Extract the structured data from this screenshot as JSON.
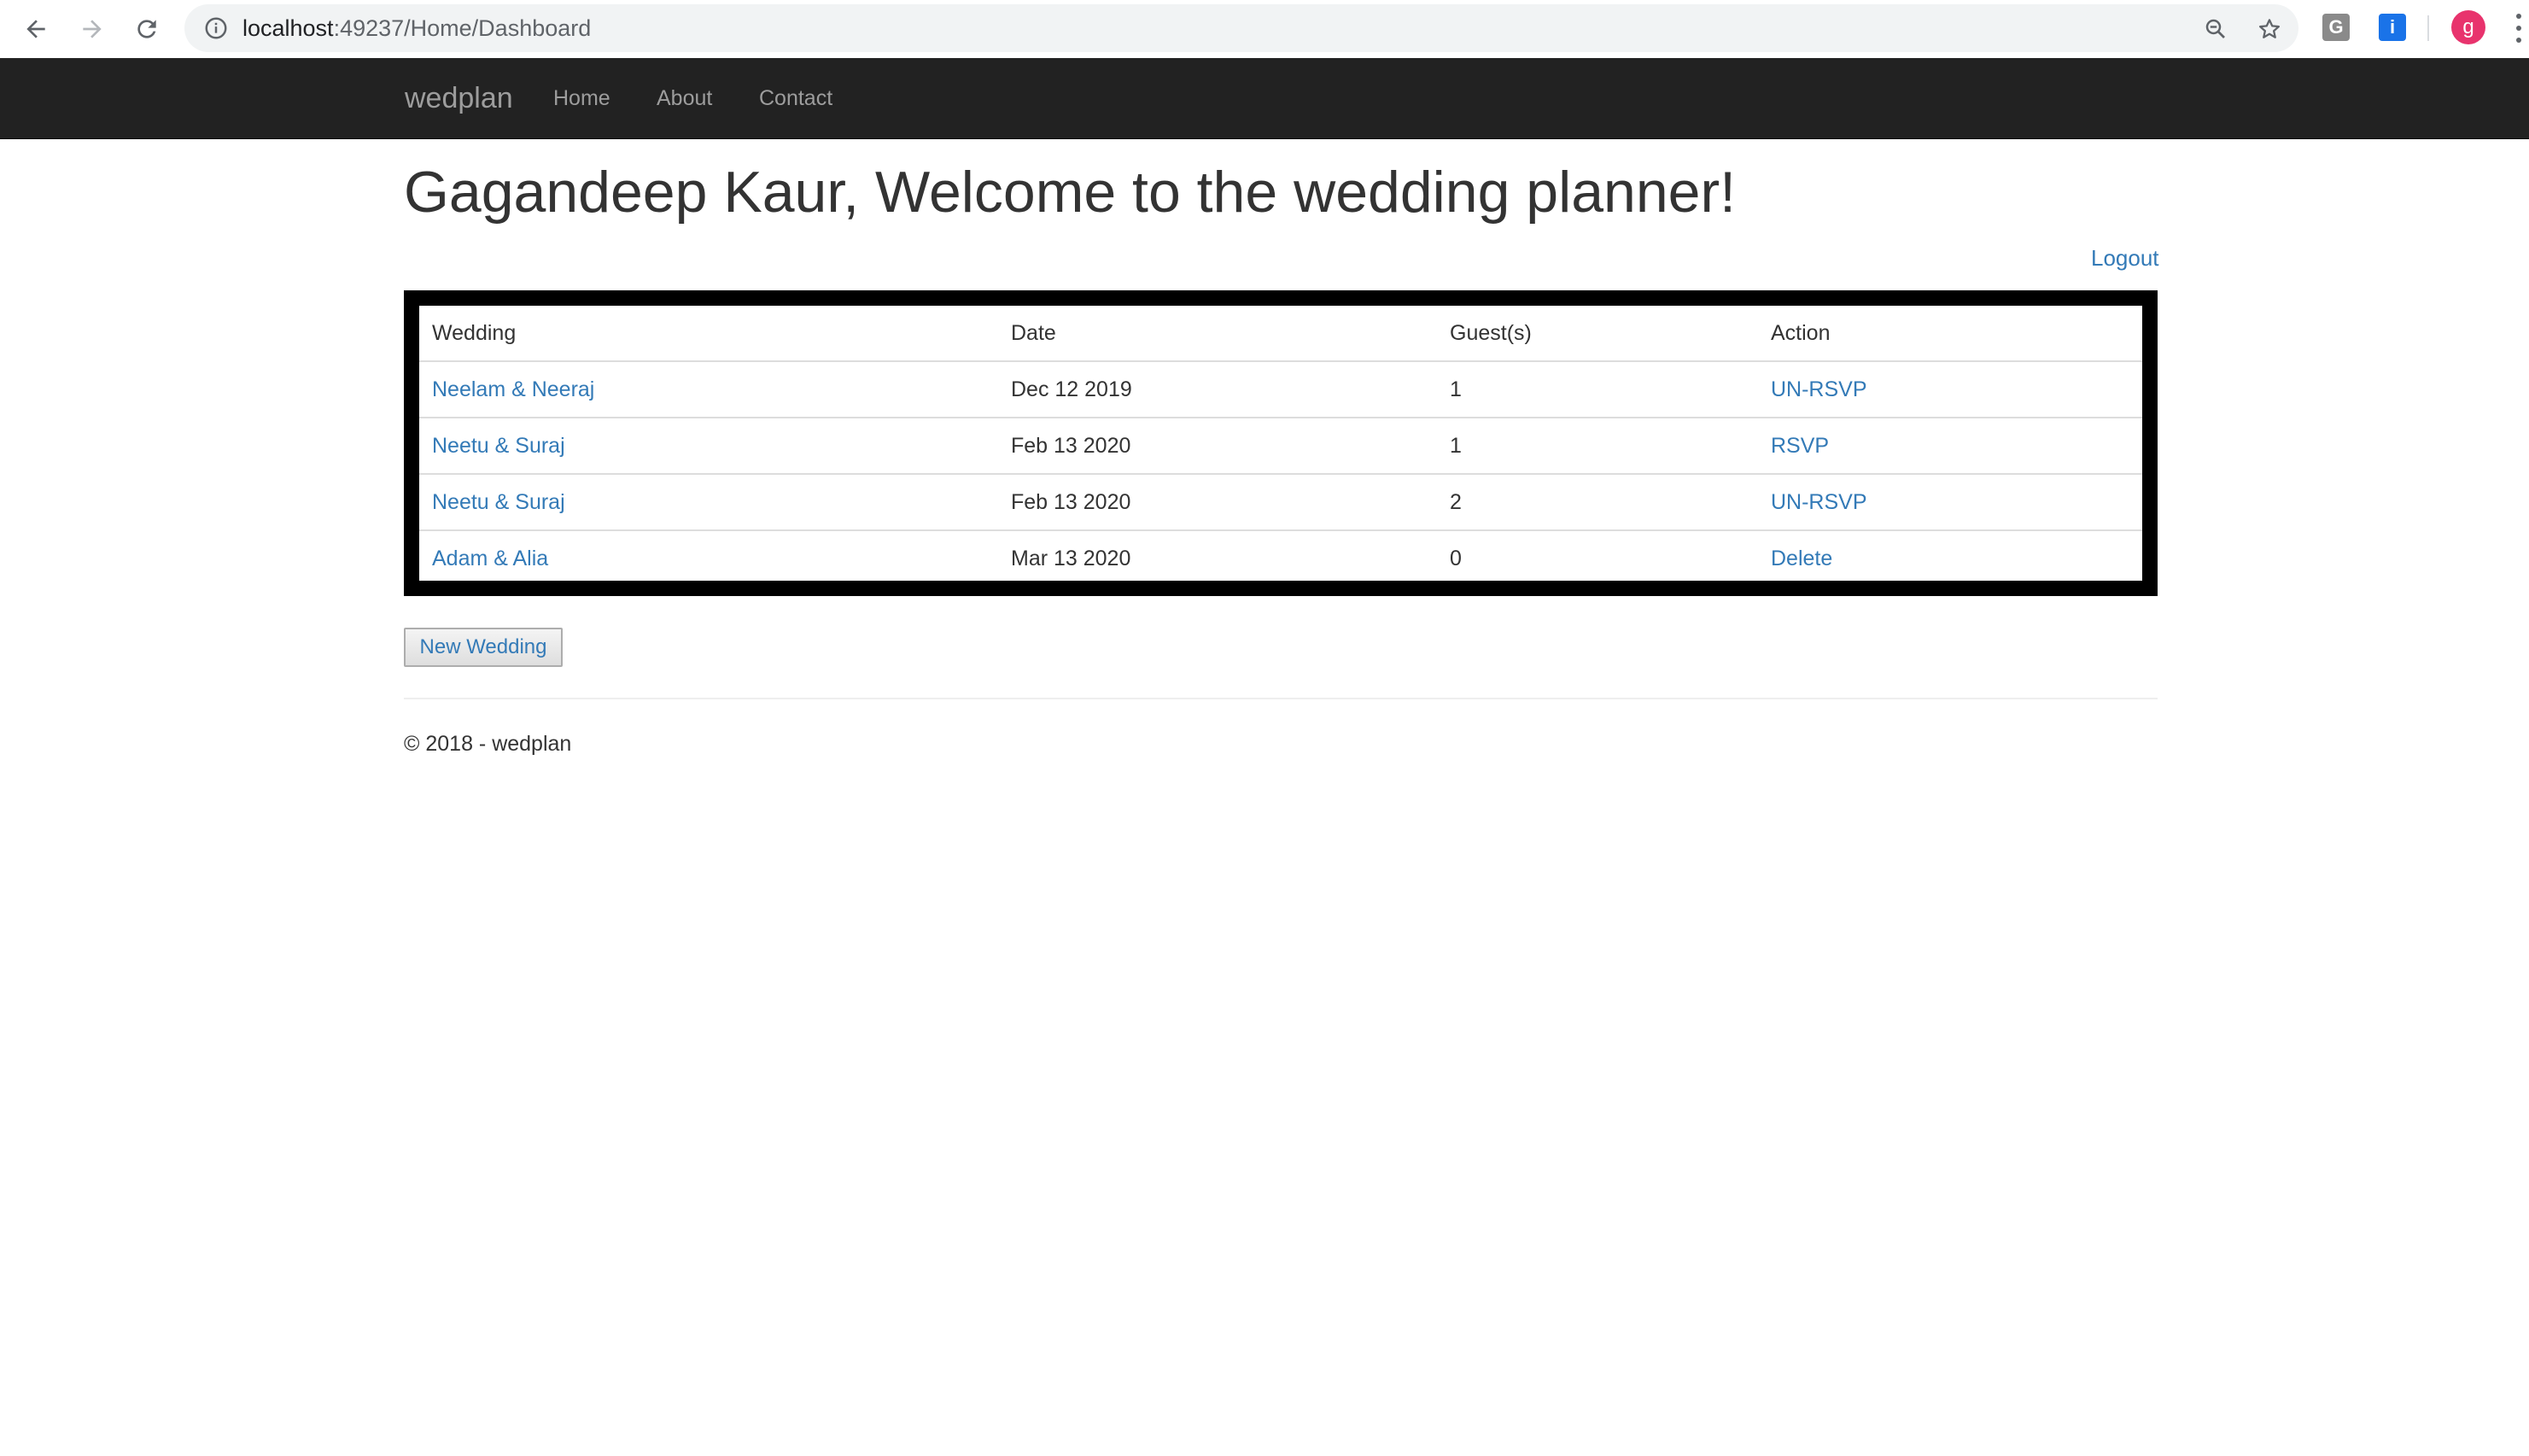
{
  "browser": {
    "url_host": "localhost",
    "url_rest": ":49237/Home/Dashboard",
    "ext_g_label": "G",
    "ext_i_label": "i",
    "avatar_letter": "g"
  },
  "navbar": {
    "brand": "wedplan",
    "links": [
      "Home",
      "About",
      "Contact"
    ]
  },
  "page": {
    "title": "Gagandeep Kaur, Welcome to the wedding planner!",
    "logout": "Logout"
  },
  "table": {
    "headers": [
      "Wedding",
      "Date",
      "Guest(s)",
      "Action"
    ],
    "rows": [
      {
        "wedding": "Neelam & Neeraj",
        "date": "Dec 12 2019",
        "guests": "1",
        "action": "UN-RSVP"
      },
      {
        "wedding": "Neetu & Suraj",
        "date": "Feb 13 2020",
        "guests": "1",
        "action": "RSVP"
      },
      {
        "wedding": "Neetu & Suraj",
        "date": "Feb 13 2020",
        "guests": "2",
        "action": "UN-RSVP"
      },
      {
        "wedding": "Adam & Alia",
        "date": "Mar 13 2020",
        "guests": "0",
        "action": "Delete"
      }
    ]
  },
  "new_wedding_button": "New Wedding",
  "footer": "© 2018 - wedplan",
  "colors": {
    "navbar": "#222222",
    "link": "#337ab7",
    "avatar": "#e8336d",
    "ext_g": "#8a8a8a",
    "ext_i": "#1a73e8"
  },
  "icons": [
    "back-icon",
    "forward-icon",
    "reload-icon",
    "info-icon",
    "zoom-icon",
    "star-icon",
    "kebab-menu-icon"
  ]
}
